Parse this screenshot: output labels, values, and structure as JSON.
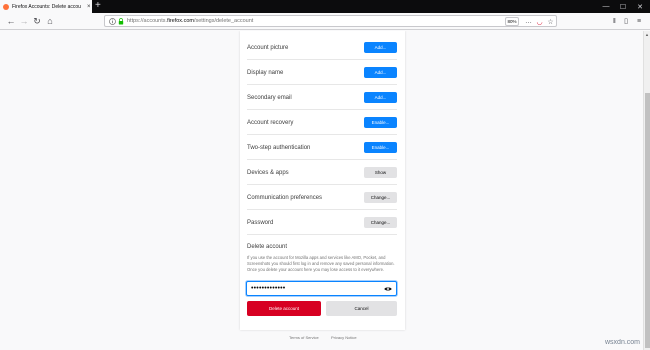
{
  "browser": {
    "tab": {
      "title": "Firefox Accounts: Delete accou",
      "close_glyph": "×"
    },
    "new_tab_glyph": "+",
    "window_controls": {
      "minimize": "—",
      "maximize": "☐",
      "close": "✕"
    },
    "nav": {
      "back": "←",
      "forward": "→",
      "reload": "↻",
      "home": "⌂"
    },
    "url": {
      "prefix": "https://accounts.",
      "domain": "firefox.com",
      "path": "/settings/delete_account"
    },
    "zoom": "80%",
    "icons": {
      "page_actions": "…",
      "pocket": "◡",
      "bookmark": "☆",
      "library": "|||",
      "sidebar": "▯",
      "menu": "≡",
      "lock": "lock-icon",
      "info": "info-icon"
    }
  },
  "settings": {
    "rows": [
      {
        "label": "Account picture",
        "button": "Add..."
      },
      {
        "label": "Display name",
        "button": "Add..."
      },
      {
        "label": "Secondary email",
        "button": "Add..."
      },
      {
        "label": "Account recovery",
        "button": "Enable..."
      },
      {
        "label": "Two-step authentication",
        "button": "Enable..."
      },
      {
        "label": "Devices & apps",
        "button": "Show"
      },
      {
        "label": "Communication preferences",
        "button": "Change..."
      },
      {
        "label": "Password",
        "button": "Change..."
      }
    ]
  },
  "delete_account": {
    "title": "Delete account",
    "description": "If you use the account for Mozilla apps and services like AMO, Pocket, and Screenshots you should first log in and remove any saved personal information. Once you delete your account here you may lose access to it everywhere.",
    "password_value": "•••••••••••••",
    "delete_label": "Delete account",
    "cancel_label": "Cancel"
  },
  "footer": {
    "terms": "Terms of Service",
    "privacy": "Privacy Notice"
  },
  "watermark": "wsxdn.com",
  "colors": {
    "primary": "#0a84ff",
    "danger": "#d70022",
    "secondary_btn": "#e2e2e4"
  }
}
